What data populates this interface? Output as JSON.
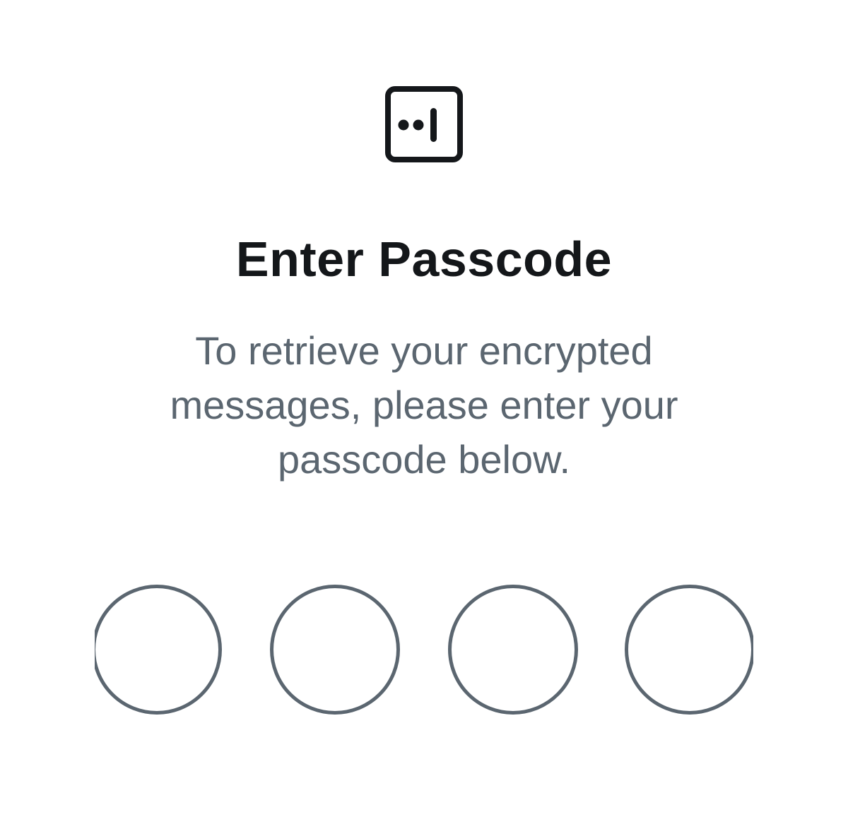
{
  "icon": "encrypted-messages-icon",
  "title": "Enter Passcode",
  "subtitle_lines": [
    "To retrieve your encrypted",
    "messages, please enter your",
    "passcode below."
  ],
  "passcode": {
    "length": 4,
    "entered": 0
  },
  "colors": {
    "background": "#ffffff",
    "title": "#14171a",
    "subtitle": "#5b6670",
    "slot_border": "#5b6670",
    "icon": "#14171a"
  }
}
